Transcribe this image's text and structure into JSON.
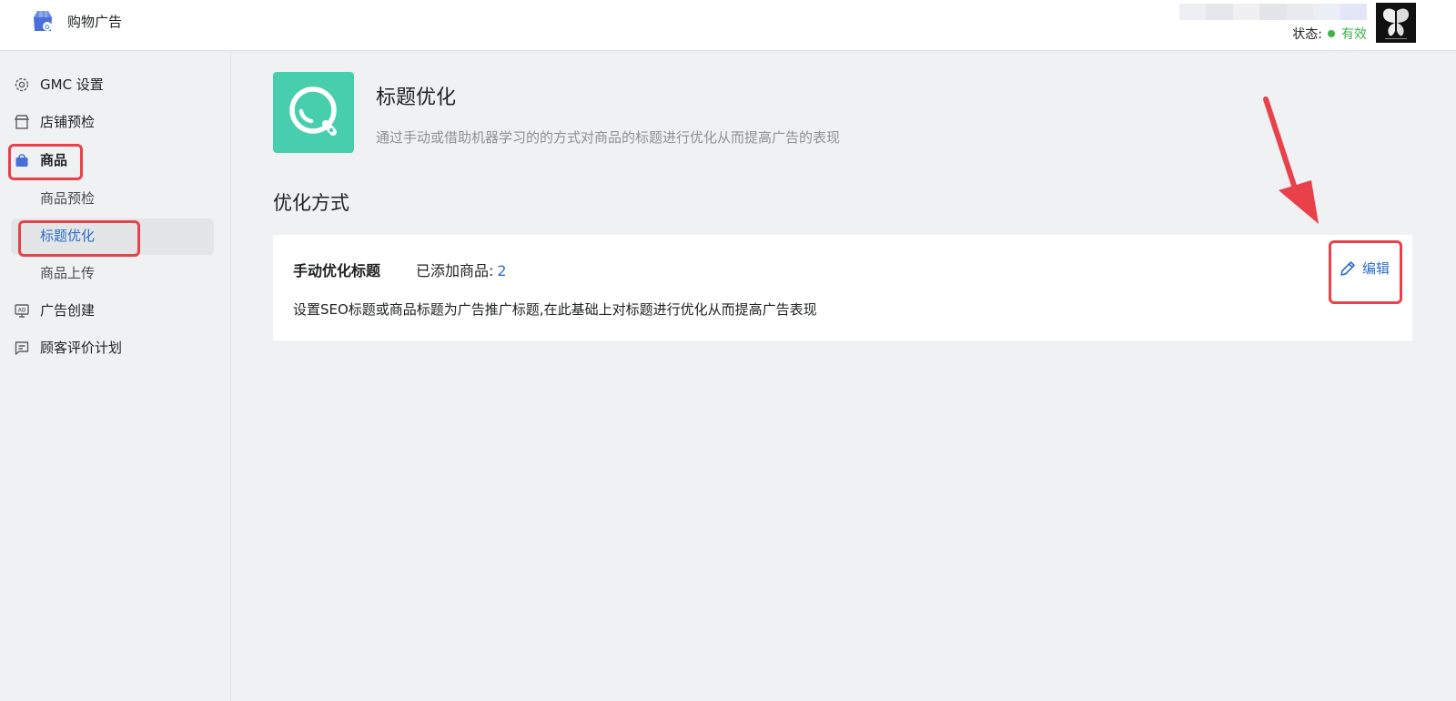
{
  "header": {
    "app_name": "购物广告",
    "status_label": "状态:",
    "status_value": "有效",
    "account_blur_colors": [
      "#eeeff2",
      "#e6e7ea",
      "#f0f0f3",
      "#e4e5e8",
      "#e9eaed",
      "#eceef6",
      "#e2e6f8"
    ]
  },
  "sidebar": {
    "items": [
      {
        "label": "GMC 设置",
        "icon": "gear-icon"
      },
      {
        "label": "店铺预检",
        "icon": "store-icon"
      },
      {
        "label": "商品",
        "icon": "shopping-bag-icon"
      },
      {
        "label": "商品预检"
      },
      {
        "label": "标题优化"
      },
      {
        "label": "商品上传"
      },
      {
        "label": "广告创建",
        "icon": "ad-icon"
      },
      {
        "label": "顾客评价计划",
        "icon": "review-icon"
      }
    ]
  },
  "main": {
    "feature": {
      "title": "标题优化",
      "description": "通过手动或借助机器学习的的方式对商品的标题进行优化从而提高广告的表现",
      "icon": "search-icon"
    },
    "section_title": "优化方式",
    "card": {
      "title": "手动优化标题",
      "count_label": "已添加商品:",
      "count_value": "2",
      "description": "设置SEO标题或商品标题为广告推广标题,在此基础上对标题进行优化从而提高广告表现",
      "edit_label": "编辑",
      "edit_icon": "pencil-icon"
    }
  },
  "colors": {
    "accent": "#2c6ecb",
    "feature_tile": "#47cfad",
    "status_green": "#3fb24c",
    "annotation_red": "#e8414a"
  }
}
